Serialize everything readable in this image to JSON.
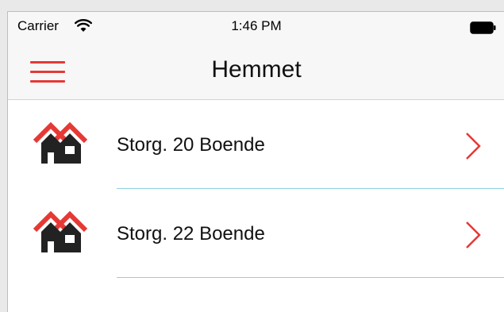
{
  "status_bar": {
    "carrier": "Carrier",
    "time": "1:46 PM",
    "wifi_icon": "wifi-icon",
    "battery_icon": "battery-icon"
  },
  "nav": {
    "menu_icon": "hamburger-menu-icon",
    "title": "Hemmet"
  },
  "list": {
    "items": [
      {
        "label": "Storg. 20 Boende",
        "icon": "house-icon",
        "chevron": "chevron-right-icon"
      },
      {
        "label": "Storg. 22 Boende",
        "icon": "house-icon",
        "chevron": "chevron-right-icon"
      }
    ]
  },
  "colors": {
    "accent": "#e53935",
    "separator": "#8ad0e0",
    "house_roof": "#e53935",
    "house_body": "#222222"
  }
}
